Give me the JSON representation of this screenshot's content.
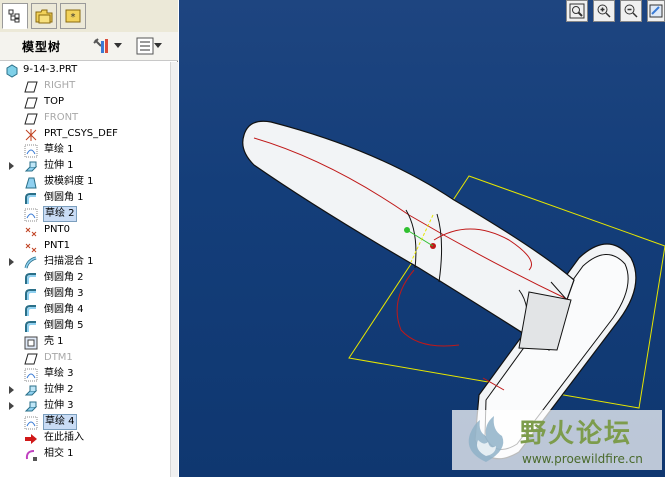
{
  "sidebar": {
    "title": "模型树",
    "tree": [
      {
        "label": "9-14-3.PRT",
        "icon": "part-icon",
        "root": true
      },
      {
        "label": "RIGHT",
        "icon": "datum-plane-icon",
        "dim": true
      },
      {
        "label": "TOP",
        "icon": "datum-plane-icon"
      },
      {
        "label": "FRONT",
        "icon": "datum-plane-icon",
        "dim": true
      },
      {
        "label": "PRT_CSYS_DEF",
        "icon": "csys-icon"
      },
      {
        "label": "草绘 1",
        "icon": "sketch-icon"
      },
      {
        "label": "拉伸 1",
        "icon": "extrude-icon",
        "expand": true
      },
      {
        "label": "拔模斜度 1",
        "icon": "draft-icon"
      },
      {
        "label": "倒圆角 1",
        "icon": "round-icon"
      },
      {
        "label": "草绘 2",
        "icon": "sketch-icon",
        "selected": true
      },
      {
        "label": "PNT0",
        "icon": "point-icon"
      },
      {
        "label": "PNT1",
        "icon": "point-icon"
      },
      {
        "label": "扫描混合 1",
        "icon": "swept-blend-icon",
        "expand": true
      },
      {
        "label": "倒圆角 2",
        "icon": "round-icon"
      },
      {
        "label": "倒圆角 3",
        "icon": "round-icon"
      },
      {
        "label": "倒圆角 4",
        "icon": "round-icon"
      },
      {
        "label": "倒圆角 5",
        "icon": "round-icon"
      },
      {
        "label": "壳 1",
        "icon": "shell-icon"
      },
      {
        "label": "DTM1",
        "icon": "datum-plane-icon",
        "dim": true
      },
      {
        "label": "草绘 3",
        "icon": "sketch-icon"
      },
      {
        "label": "拉伸 2",
        "icon": "extrude-icon",
        "expand": true
      },
      {
        "label": "拉伸 3",
        "icon": "extrude-icon",
        "expand": true
      },
      {
        "label": "草绘 4",
        "icon": "sketch-icon",
        "selected": true
      },
      {
        "label": "在此插入",
        "icon": "insert-arrow-icon"
      },
      {
        "label": "相交 1",
        "icon": "intersect-icon"
      }
    ]
  },
  "watermark": {
    "text": "野火论坛",
    "url": "www.proewildfire.cn"
  },
  "colors": {
    "viewport_bg": "#143e7a",
    "selection": "#c9dcf5",
    "datum_frame": "#e6e600",
    "curve": "#c01818"
  }
}
